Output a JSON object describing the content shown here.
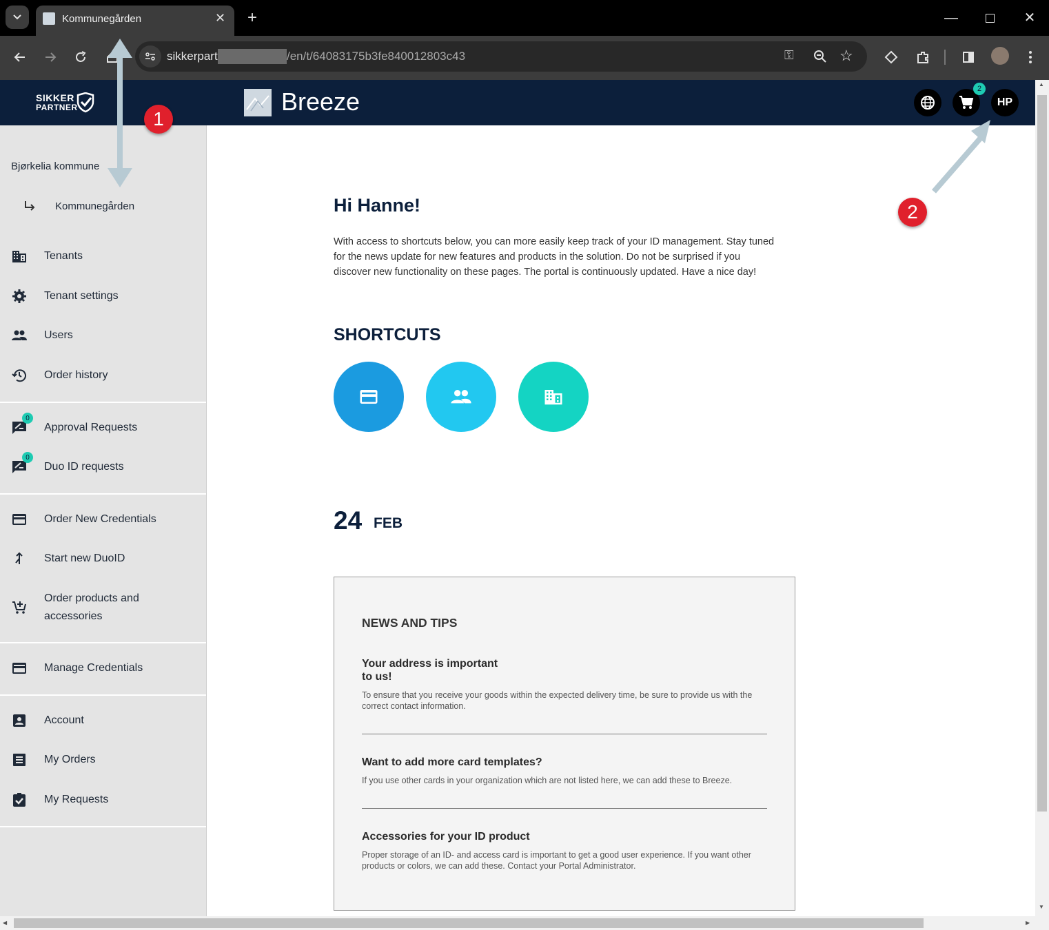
{
  "browser": {
    "tab_title": "Kommunegården",
    "url_host": "sikkerpart",
    "url_path": "/en/t/64083175b3fe840012803c43",
    "cart_count": "2"
  },
  "header": {
    "logo_line1": "SIKKER",
    "logo_line2": "PARTNER",
    "app_name": "Breeze",
    "avatar_initials": "HP",
    "cart_badge": "2"
  },
  "sidebar": {
    "org": "Bjørkelia kommune",
    "sub_org": "Kommunegården",
    "items": [
      {
        "label": "Tenants",
        "icon": "building-icon"
      },
      {
        "label": "Tenant settings",
        "icon": "gear-icon"
      },
      {
        "label": "Users",
        "icon": "users-icon"
      },
      {
        "label": "Order history",
        "icon": "history-icon"
      },
      {
        "label": "Approval Requests",
        "icon": "approval-icon",
        "badge": "0"
      },
      {
        "label": "Duo ID requests",
        "icon": "approval-icon",
        "badge": "0"
      },
      {
        "label": "Order New Credentials",
        "icon": "card-icon"
      },
      {
        "label": "Start new DuoID",
        "icon": "merge-icon"
      },
      {
        "label": "Order products and accessories",
        "icon": "cart-add-icon"
      },
      {
        "label": "Manage Credentials",
        "icon": "card-icon"
      },
      {
        "label": "Account",
        "icon": "account-icon"
      },
      {
        "label": "My Orders",
        "icon": "list-icon"
      },
      {
        "label": "My Requests",
        "icon": "clipboard-check-icon"
      }
    ]
  },
  "main": {
    "greeting": "Hi Hanne!",
    "intro_line1": "With access to shortcuts below, you can more easily keep track of your ID management. Stay tuned",
    "intro_line2": "for the news update for new features and products in the solution. Do not be surprised if you",
    "intro_line3": "discover new functionality on these pages. The portal is continuously updated. Have a nice day!",
    "shortcuts_heading": "SHORTCUTS",
    "shortcuts": [
      {
        "icon": "card-icon",
        "color": "#1b9be0"
      },
      {
        "icon": "users-icon",
        "color": "#22c8f0"
      },
      {
        "icon": "building-icon",
        "color": "#14d4c3"
      }
    ],
    "date_day": "24",
    "date_month": "FEB",
    "news": {
      "heading": "NEWS AND TIPS",
      "items": [
        {
          "title_line1": "Your address is important",
          "title_line2": "to us!",
          "body_line1": "To ensure that you receive your goods within the expected delivery time, be sure to provide us with the",
          "body_line2": "correct contact information."
        },
        {
          "title_line1": "Want to add more card templates?",
          "body_line1": "If you use other cards in your organization which are not listed here, we can add these to Breeze."
        },
        {
          "title_line1": "Accessories for your ID product",
          "body_line1": "Proper storage of an ID- and access card is important to get a good user experience. If you want other",
          "body_line2": "products or colors, we can add these. Contact your Portal Administrator."
        }
      ]
    }
  },
  "annotations": {
    "marker1": "1",
    "marker2": "2"
  },
  "colors": {
    "header_bg": "#0c1f3b",
    "sidebar_bg": "#e4e4e4",
    "badge": "#1ecbb2"
  }
}
